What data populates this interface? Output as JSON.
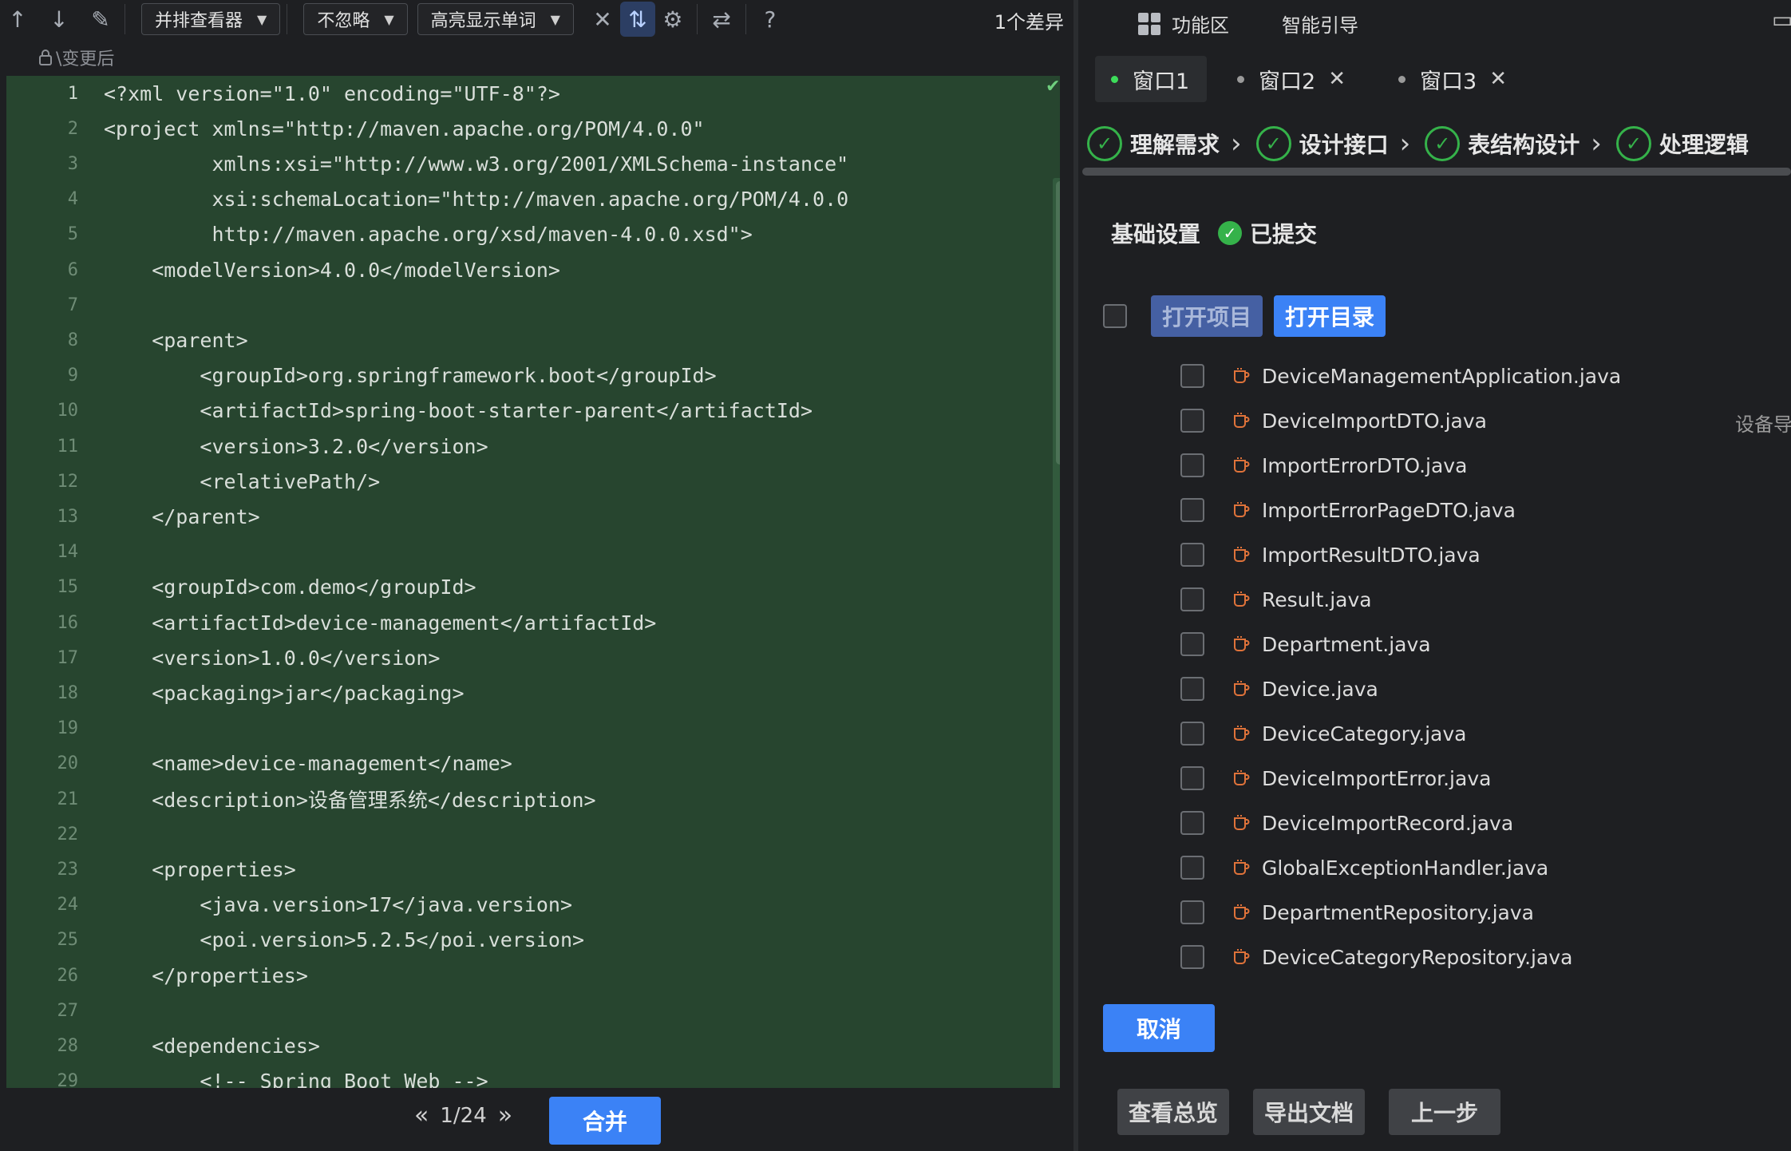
{
  "toolbar": {
    "icons": [
      "arrow-up-icon",
      "arrow-down-icon",
      "pencil-icon"
    ],
    "viewer_mode": "并排查看器",
    "ignore_mode": "不忽略",
    "highlight_mode": "高亮显示单词",
    "diff_count": "1个差异"
  },
  "editor": {
    "subtitle": "\\变更后",
    "lines": [
      {
        "n": "1",
        "t": "<?xml version=\"1.0\" encoding=\"UTF-8\"?>"
      },
      {
        "n": "2",
        "t": "<project xmlns=\"http://maven.apache.org/POM/4.0.0\""
      },
      {
        "n": "3",
        "t": "         xmlns:xsi=\"http://www.w3.org/2001/XMLSchema-instance\""
      },
      {
        "n": "4",
        "t": "         xsi:schemaLocation=\"http://maven.apache.org/POM/4.0.0"
      },
      {
        "n": "5",
        "t": "         http://maven.apache.org/xsd/maven-4.0.0.xsd\">"
      },
      {
        "n": "6",
        "t": "    <modelVersion>4.0.0</modelVersion>"
      },
      {
        "n": "7",
        "t": ""
      },
      {
        "n": "8",
        "t": "    <parent>"
      },
      {
        "n": "9",
        "t": "        <groupId>org.springframework.boot</groupId>"
      },
      {
        "n": "10",
        "t": "        <artifactId>spring-boot-starter-parent</artifactId>"
      },
      {
        "n": "11",
        "t": "        <version>3.2.0</version>"
      },
      {
        "n": "12",
        "t": "        <relativePath/>"
      },
      {
        "n": "13",
        "t": "    </parent>"
      },
      {
        "n": "14",
        "t": ""
      },
      {
        "n": "15",
        "t": "    <groupId>com.demo</groupId>"
      },
      {
        "n": "16",
        "t": "    <artifactId>device-management</artifactId>"
      },
      {
        "n": "17",
        "t": "    <version>1.0.0</version>"
      },
      {
        "n": "18",
        "t": "    <packaging>jar</packaging>"
      },
      {
        "n": "19",
        "t": ""
      },
      {
        "n": "20",
        "t": "    <name>device-management</name>"
      },
      {
        "n": "21",
        "t": "    <description>设备管理系统</description>"
      },
      {
        "n": "22",
        "t": ""
      },
      {
        "n": "23",
        "t": "    <properties>"
      },
      {
        "n": "24",
        "t": "        <java.version>17</java.version>"
      },
      {
        "n": "25",
        "t": "        <poi.version>5.2.5</poi.version>"
      },
      {
        "n": "26",
        "t": "    </properties>"
      },
      {
        "n": "27",
        "t": ""
      },
      {
        "n": "28",
        "t": "    <dependencies>"
      },
      {
        "n": "29",
        "t": "        <!-- Spring Boot Web -->"
      }
    ]
  },
  "pager": {
    "text": "1/24"
  },
  "merge_label": "合并",
  "right": {
    "top_tabs": [
      "功能区",
      "智能引导"
    ],
    "window_tabs": [
      {
        "label": "窗口1"
      },
      {
        "label": "窗口2"
      },
      {
        "label": "窗口3"
      }
    ],
    "steps": [
      "理解需求",
      "设计接口",
      "表结构设计",
      "处理逻辑"
    ],
    "basic_settings": "基础设置",
    "status": "已提交",
    "open_project": "打开项目",
    "open_directory": "打开目录",
    "side_text": "设备导",
    "files": [
      "DeviceManagementApplication.java",
      "DeviceImportDTO.java",
      "ImportErrorDTO.java",
      "ImportErrorPageDTO.java",
      "ImportResultDTO.java",
      "Result.java",
      "Department.java",
      "Device.java",
      "DeviceCategory.java",
      "DeviceImportError.java",
      "DeviceImportRecord.java",
      "GlobalExceptionHandler.java",
      "DepartmentRepository.java",
      "DeviceCategoryRepository.java"
    ],
    "cancel": "取消",
    "bottom_buttons": [
      "查看总览",
      "导出文档",
      "上一步"
    ]
  },
  "colors": {
    "accent": "#3b82f6",
    "success": "#35b24a",
    "diff_bg": "#27452f",
    "file_icon": "#e0733a"
  }
}
